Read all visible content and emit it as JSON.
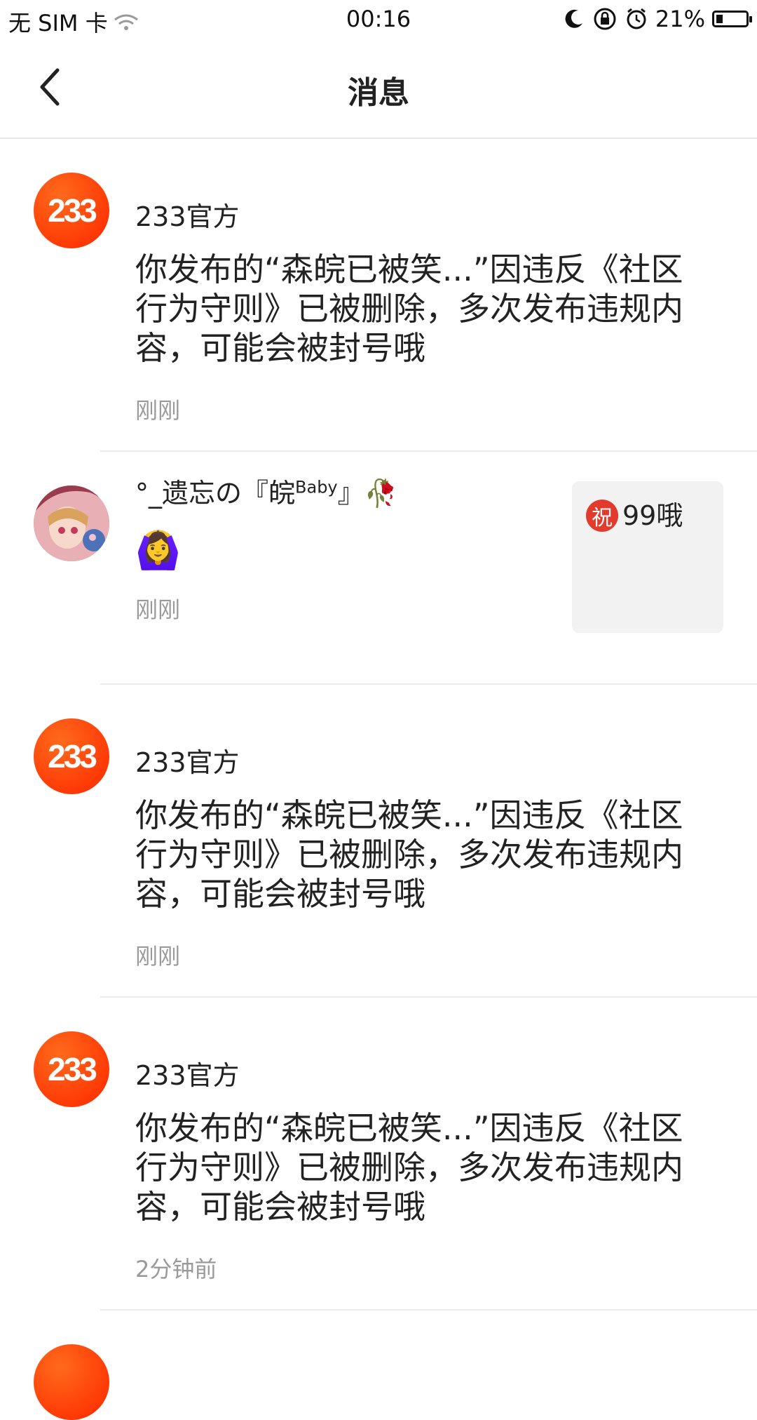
{
  "status_bar": {
    "carrier": "无 SIM 卡",
    "time": "00:16",
    "battery": "21%",
    "battery_level": 0.21,
    "icons": [
      "wifi-icon",
      "moon-icon",
      "rotation-lock-icon",
      "alarm-icon",
      "battery-icon"
    ]
  },
  "nav": {
    "title": "消息",
    "back_icon": "chevron-left-icon"
  },
  "messages": [
    {
      "sender": "233官方",
      "avatar_text": "233",
      "content": "你发布的“森皖已被笑...”因违反《社区行为守则》已被删除，多次发布违规内容，可能会被封号哦",
      "time": "刚刚"
    },
    {
      "sender_prefix": "°_遗忘の『皖",
      "sender_sup": "Baby",
      "sender_suffix": "』🥀",
      "content": "🙆‍♀️",
      "time": "刚刚",
      "reply_badge": "祝",
      "reply_text": "99哦"
    },
    {
      "sender": "233官方",
      "avatar_text": "233",
      "content": "你发布的“森皖已被笑...”因违反《社区行为守则》已被删除，多次发布违规内容，可能会被封号哦",
      "time": "刚刚"
    },
    {
      "sender": "233官方",
      "avatar_text": "233",
      "content": "你发布的“森皖已被笑...”因违反《社区行为守则》已被删除，多次发布违规内容，可能会被封号哦",
      "time": "2分钟前"
    }
  ],
  "colors": {
    "brand_orange": "#ff4a0a",
    "divider": "#ebebeb",
    "time_gray": "#9a9a9a",
    "reply_bg": "#f2f2f2"
  }
}
